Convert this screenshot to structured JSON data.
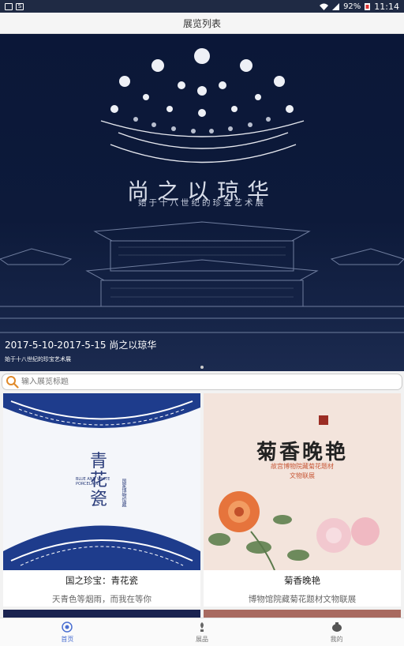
{
  "status_bar": {
    "battery": "92%",
    "time": "11:14"
  },
  "title_bar": {
    "title": "展览列表"
  },
  "banner": {
    "calligraphy": "尚之以琼华",
    "subtitle": "始于十八世纪的珍宝艺术展",
    "caption": "2017-5-10-2017-5-15  尚之以琼华",
    "caption_sub": "始于十八世纪的珍宝艺术展"
  },
  "search": {
    "placeholder": "输入展览标题"
  },
  "cards": [
    {
      "title": "国之珍宝：青花瓷",
      "desc": "天青色等烟雨，而我在等你",
      "image_title": "青花瓷",
      "image_en": "BLUE AND WHITE PORCELAIN",
      "image_cn": "国家博物馆藏",
      "icon": "blue-white-porcelain-image"
    },
    {
      "title": "菊香晚艳",
      "desc": "博物馆院藏菊花题材文物联展",
      "image_title": "菊香晚艳",
      "image_sub1": "故宫博物院藏菊花题材",
      "image_sub2": "文物联展",
      "icon": "chrysanthemum-image"
    }
  ],
  "tabs": [
    {
      "label": "首页",
      "icon": "home-icon",
      "active": true
    },
    {
      "label": "展品",
      "icon": "exhibit-icon",
      "active": false
    },
    {
      "label": "我的",
      "icon": "profile-icon",
      "active": false
    }
  ],
  "colors": {
    "banner_bg": "#0d1a3a",
    "status_bar": "#1f2a44",
    "tab_active": "#4a6fd1",
    "search_icon": "#e08a2a"
  }
}
